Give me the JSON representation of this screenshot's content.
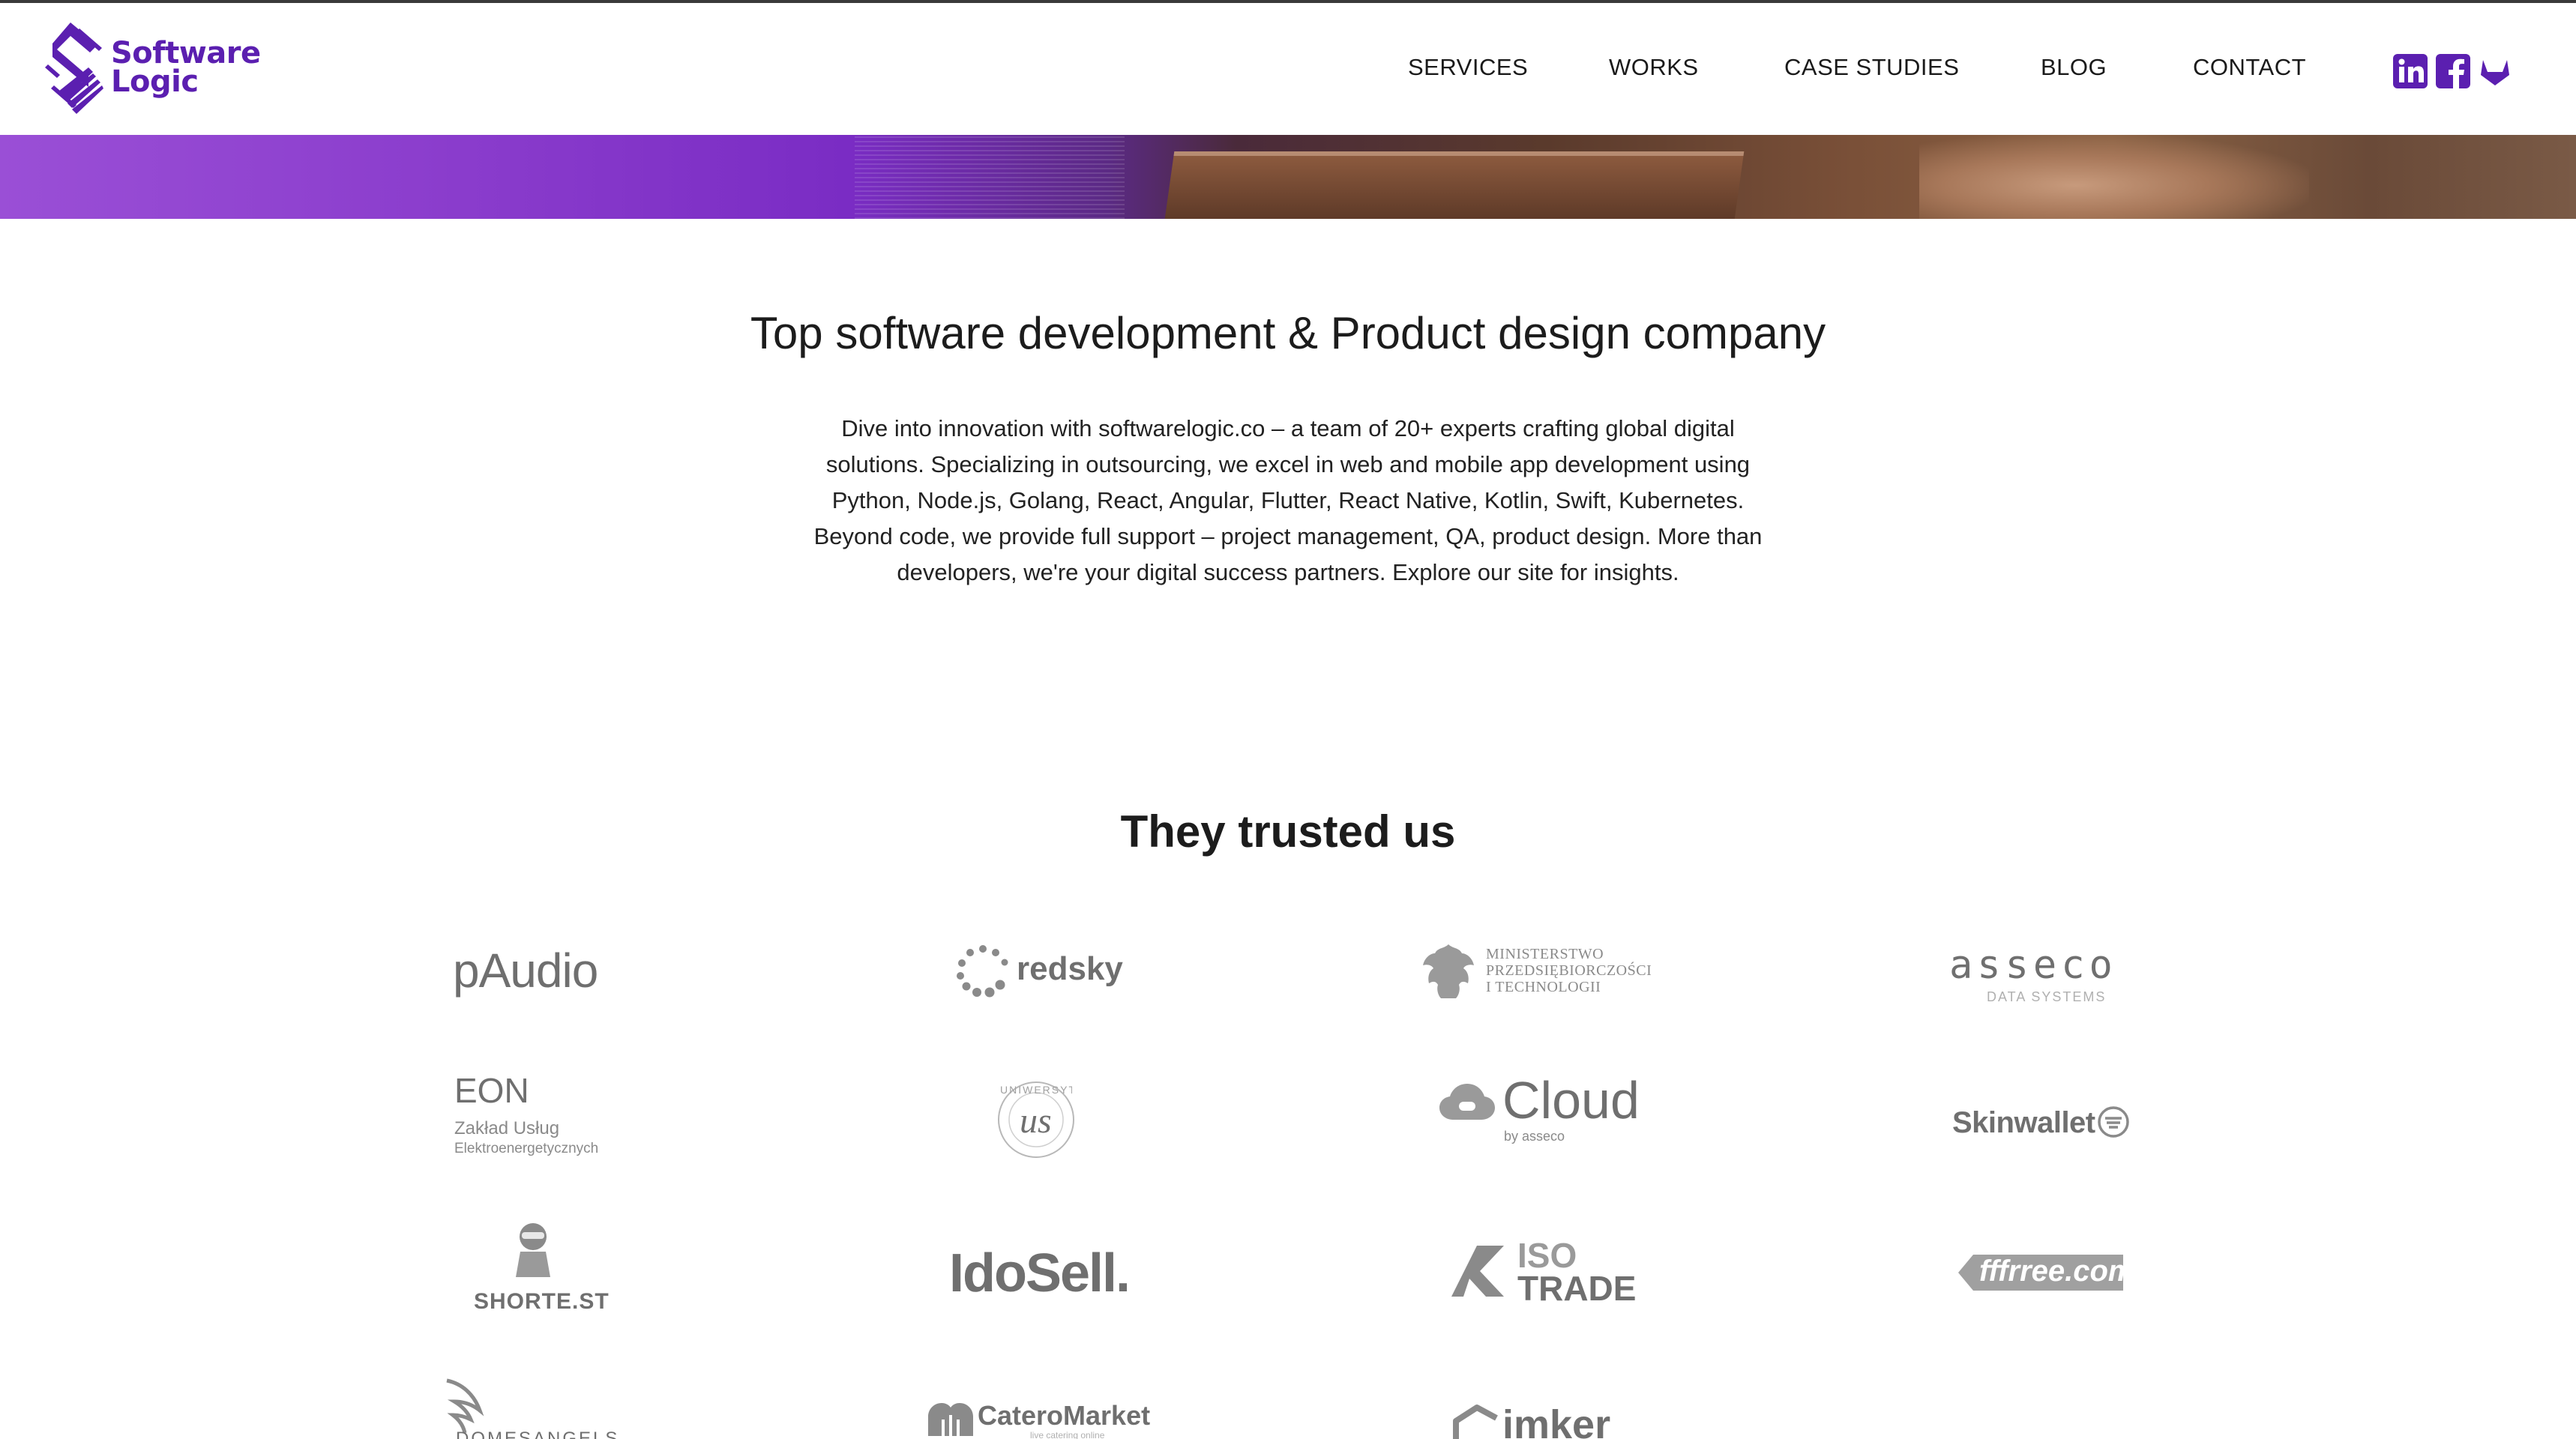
{
  "brand": {
    "name_line1": "Software",
    "name_line2": "Logic",
    "color": "#5b1fb0"
  },
  "nav": {
    "items": [
      "SERVICES",
      "WORKS",
      "CASE STUDIES",
      "BLOG",
      "CONTACT"
    ]
  },
  "social": {
    "icons": [
      "linkedin-icon",
      "facebook-icon",
      "gitlab-icon"
    ]
  },
  "intro": {
    "title": "Top software development & Product design company",
    "body": "Dive into innovation with softwarelogic.co – a team of 20+ experts crafting global digital solutions. Specializing in outsourcing, we excel in web and mobile app development using Python, Node.js, Golang, React, Angular, Flutter, React Native, Kotlin, Swift, Kubernetes. Beyond code, we provide full support – project management, QA, product design. More than developers, we're your digital success partners. Explore our site for insights."
  },
  "clients": {
    "title": "They trusted us",
    "logos": {
      "paudio": "pAudio",
      "redsky": "redsky",
      "ministry_1": "MINISTERSTWO",
      "ministry_2": "PRZEDSIĘBIORCZOŚCI",
      "ministry_3": "I TECHNOLOGII",
      "asseco": "asseco",
      "asseco_sub": "DATA SYSTEMS",
      "eon": "EON",
      "eon_sub1": "Zakład Usług",
      "eon_sub2": "Elektroenergetycznych",
      "univ_ring": "UNIWERSYTET SZCZECIŃSKI",
      "univ_mono": "us",
      "cloud": "Cloud",
      "cloud_sub": "by asseco",
      "skinwallet": "Skinwallet",
      "shortest": "SHORTE.ST",
      "idosell": "IdoSell.",
      "isotrade_1": "ISO",
      "isotrade_2": "TRADE",
      "fffrree": "fffrree.com",
      "domesangels": "DOMESANGELS",
      "cateromarket": "CateroMarket",
      "cateromarket_sub": "live catering online",
      "imker": "imker"
    }
  },
  "colors": {
    "accent": "#5b1fb0",
    "hero_purple": "#8a3ccc",
    "logo_gray": "#7d7d7d"
  }
}
